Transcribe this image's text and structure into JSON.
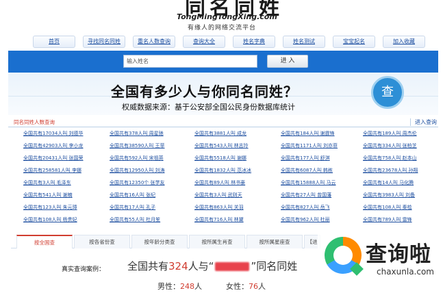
{
  "header": {
    "logo_cn": "同名同姓",
    "logo_en": "TongMingTongXing.com",
    "slogan": "有缘人的网络交流平台"
  },
  "nav": [
    "首页",
    "寻找同名同姓",
    "重名人数查询",
    "查询大全",
    "姓名字典",
    "姓名测试",
    "宝宝起名",
    "加入收藏"
  ],
  "search": {
    "placeholder": "输入姓名",
    "button": "进 入"
  },
  "banner": {
    "title": "全国有多少人与你同名同姓？",
    "subtitle": "权威数据来源：基于公安部全国公民身份数据库统计",
    "badge": "查"
  },
  "query_section": {
    "title": "同名同姓人数查询",
    "more_link": "进入查询"
  },
  "grid": [
    [
      "全国共有17034人叫 刘德华",
      "全国共有378人叫 周星驰",
      "全国共有3881人叫 成龙",
      "全国共有184人叫 谢霆锋",
      "全国共有189人叫 周杰伦"
    ],
    [
      "全国共有42903人叫 李小龙",
      "全国共有38590人叫 王菲",
      "全国共有543人叫 林志玲",
      "全国共有1171人叫 刘亦菲",
      "全国共有334人叫 张柏芝"
    ],
    [
      "全国共有20431人叫 张国荣",
      "全国共有592人叫 宋祖英",
      "全国共有5518人叫 谢娜",
      "全国共有177人叫 舒淇",
      "全国共有758人叫 赵本山"
    ],
    [
      "全国共有258581人叫 李娜",
      "全国共有12950人叫 刘涛",
      "全国共有1832人叫 范冰冰",
      "全国共有6087人叫 韩栋",
      "全国共有23678人叫 孙翔"
    ],
    [
      "全国共有3人叫 毛泽东",
      "全国共有12350个 张学友",
      "全国共有89人叫 林书豪",
      "全国共有15888人叫 马云",
      "全国共有14人叫 马化腾"
    ],
    [
      "全国共有541人叫 谢楠",
      "全国共有16人叫 张纪",
      "全国共有3人叫 武则天",
      "全国共有27人叫 曾国藩",
      "全国共有3983人叫 刘备"
    ],
    [
      "全国共有123人叫 朱元璋",
      "全国共有17人叫 孔子",
      "全国共有863人叫 关羽",
      "全国共有827人叫 岳飞",
      "全国共有108人叫 秦桧"
    ],
    [
      "全国共有108人叫 杨贵妃",
      "全国共有55人叫 杜月笙",
      "全国共有716人叫 林黛",
      "全国共有962人叫 杜丽",
      "全国共有789人叫 雷锋"
    ]
  ],
  "tabs": [
    "按全国查",
    "按各省份查",
    "按年龄分类查",
    "按所属生肖查",
    "按所属星座查",
    "【进"
  ],
  "result": {
    "label": "真实查询案例：",
    "pre": "全国共有",
    "count": "324",
    "mid": "人与“",
    "post": "”同名同姓",
    "male_label": "男性：",
    "male_count": "248",
    "female_label": "女性：",
    "female_count": "76",
    "unit": "人"
  },
  "watermark": {
    "title": "查询啦",
    "url": "chaxunla.com"
  }
}
